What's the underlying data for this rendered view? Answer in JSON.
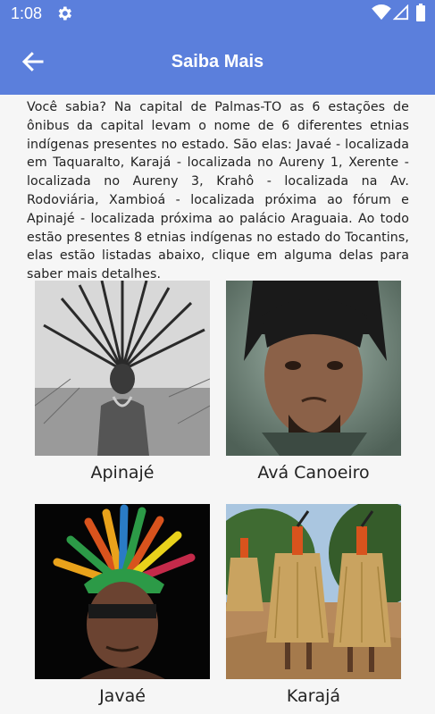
{
  "status_bar": {
    "time": "1:08",
    "icons": [
      "gear-icon",
      "wifi-icon",
      "signal-icon",
      "battery-icon"
    ]
  },
  "app_bar": {
    "title": "Saiba Mais",
    "back_icon": "arrow-left-icon",
    "color": "#5b7fdc"
  },
  "intro_text": "Você sabia? Na capital de Palmas-TO as 6 estações de ônibus da capital levam o nome de 6 diferentes etnias indígenas presentes no estado. São elas: Javaé - localizada em Taquaralto, Karajá - localizada no Aureny 1, Xerente - localizada no Aureny 3, Krahô - localizada na Av. Rodoviária, Xambioá - localizada próxima ao fórum e Apinajé - localizada próxima ao palácio Araguaia. Ao todo estão presentes 8 etnias indígenas no estado do Tocantins, elas estão listadas abaixo, clique em alguma delas para saber mais detalhes.",
  "ethnicities": [
    {
      "name": "Apinajé"
    },
    {
      "name": "Avá Canoeiro"
    },
    {
      "name": "Javaé"
    },
    {
      "name": "Karajá"
    }
  ]
}
